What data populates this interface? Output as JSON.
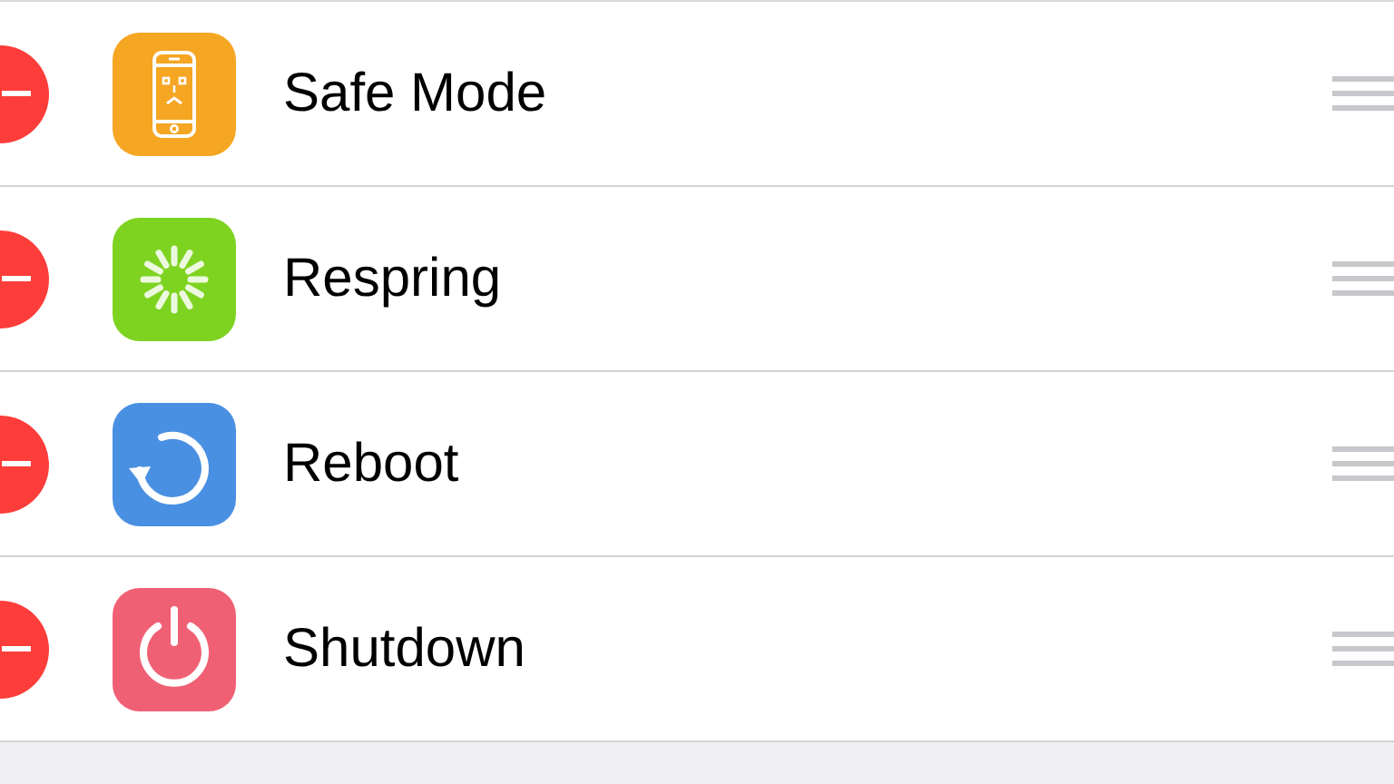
{
  "rows": [
    {
      "label": "Safe Mode",
      "kind": "phone",
      "color": "#f5a623"
    },
    {
      "label": "Respring",
      "kind": "spinner",
      "color": "#7ed321"
    },
    {
      "label": "Reboot",
      "kind": "reboot",
      "color": "#4a90e2"
    },
    {
      "label": "Shutdown",
      "kind": "power",
      "color": "#f06074"
    }
  ]
}
